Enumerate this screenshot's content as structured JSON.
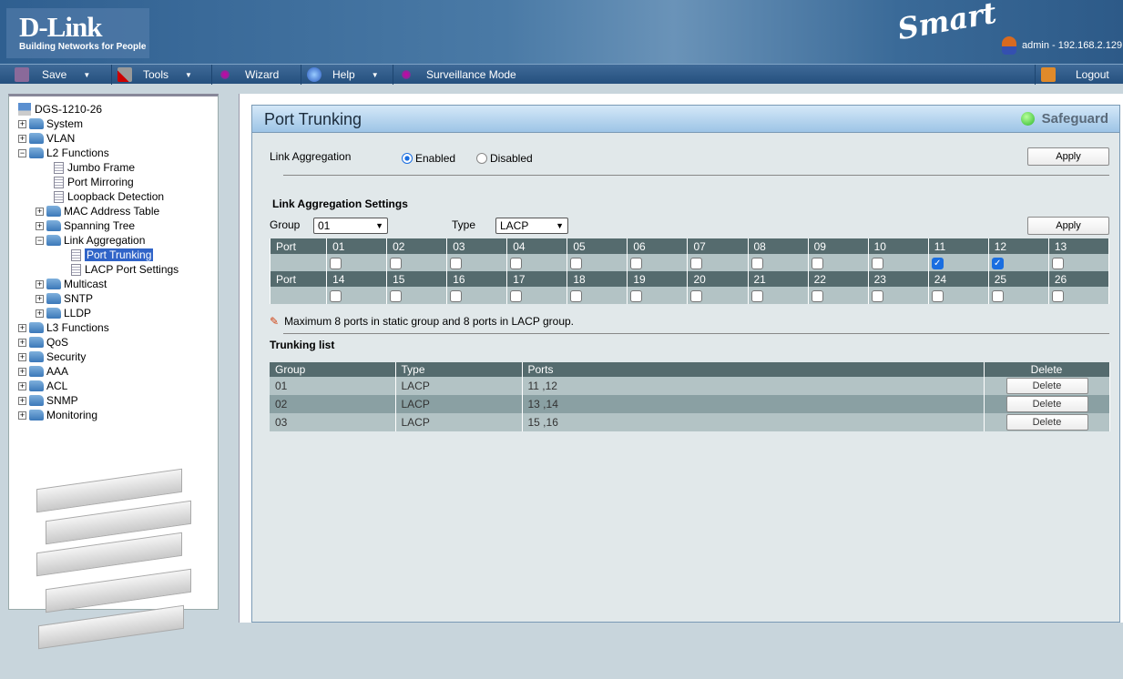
{
  "header": {
    "brand": "D-Link",
    "tagline": "Building Networks for People",
    "product_line": "Smart",
    "user": "admin - 192.168.2.129"
  },
  "menu": [
    {
      "label": "Save",
      "icon": "floppy-icon",
      "dropdown": true
    },
    {
      "label": "Tools",
      "icon": "tools-icon",
      "dropdown": true
    },
    {
      "label": "Wizard",
      "icon": "wand-icon",
      "dropdown": false
    },
    {
      "label": "Help",
      "icon": "help-icon",
      "dropdown": true
    },
    {
      "label": "Surveillance Mode",
      "icon": "wand-icon",
      "dropdown": false
    }
  ],
  "logout": "Logout",
  "tree": [
    {
      "label": "DGS-1210-26",
      "level": 0,
      "kind": "device"
    },
    {
      "label": "System",
      "level": 0,
      "kind": "folder",
      "exp": "+"
    },
    {
      "label": "VLAN",
      "level": 0,
      "kind": "folder",
      "exp": "+"
    },
    {
      "label": "L2 Functions",
      "level": 0,
      "kind": "folder",
      "exp": "-"
    },
    {
      "label": "Jumbo Frame",
      "level": 1,
      "kind": "page"
    },
    {
      "label": "Port Mirroring",
      "level": 1,
      "kind": "page"
    },
    {
      "label": "Loopback Detection",
      "level": 1,
      "kind": "page"
    },
    {
      "label": "MAC Address Table",
      "level": 1,
      "kind": "folder",
      "exp": "+"
    },
    {
      "label": "Spanning Tree",
      "level": 1,
      "kind": "folder",
      "exp": "+"
    },
    {
      "label": "Link Aggregation",
      "level": 1,
      "kind": "folder",
      "exp": "-"
    },
    {
      "label": "Port Trunking",
      "level": 2,
      "kind": "page",
      "selected": true
    },
    {
      "label": "LACP Port Settings",
      "level": 2,
      "kind": "page"
    },
    {
      "label": "Multicast",
      "level": 1,
      "kind": "folder",
      "exp": "+"
    },
    {
      "label": "SNTP",
      "level": 1,
      "kind": "folder",
      "exp": "+"
    },
    {
      "label": "LLDP",
      "level": 1,
      "kind": "folder",
      "exp": "+"
    },
    {
      "label": "L3 Functions",
      "level": 0,
      "kind": "folder",
      "exp": "+"
    },
    {
      "label": "QoS",
      "level": 0,
      "kind": "folder",
      "exp": "+"
    },
    {
      "label": "Security",
      "level": 0,
      "kind": "folder",
      "exp": "+"
    },
    {
      "label": "AAA",
      "level": 0,
      "kind": "folder",
      "exp": "+"
    },
    {
      "label": "ACL",
      "level": 0,
      "kind": "folder",
      "exp": "+"
    },
    {
      "label": "SNMP",
      "level": 0,
      "kind": "folder",
      "exp": "+"
    },
    {
      "label": "Monitoring",
      "level": 0,
      "kind": "folder",
      "exp": "+"
    }
  ],
  "page": {
    "title": "Port Trunking",
    "safeguard": "Safeguard",
    "link_aggregation": {
      "label": "Link Aggregation",
      "enabled": "Enabled",
      "disabled": "Disabled",
      "selected": "Enabled",
      "apply": "Apply"
    },
    "settings": {
      "heading": "Link Aggregation Settings",
      "group_label": "Group",
      "group_value": "01",
      "type_label": "Type",
      "type_value": "LACP",
      "apply": "Apply",
      "port_label": "Port",
      "ports_row1": [
        "01",
        "02",
        "03",
        "04",
        "05",
        "06",
        "07",
        "08",
        "09",
        "10",
        "11",
        "12",
        "13"
      ],
      "ports_row2": [
        "14",
        "15",
        "16",
        "17",
        "18",
        "19",
        "20",
        "21",
        "22",
        "23",
        "24",
        "25",
        "26"
      ],
      "checked": [
        "11",
        "12"
      ]
    },
    "note": "Maximum 8 ports in static group and 8 ports in LACP group.",
    "trunking_list": {
      "heading": "Trunking list",
      "columns": [
        "Group",
        "Type",
        "Ports",
        "Delete"
      ],
      "rows": [
        {
          "group": "01",
          "type": "LACP",
          "ports": "11 ,12",
          "action": "Delete"
        },
        {
          "group": "02",
          "type": "LACP",
          "ports": "13 ,14",
          "action": "Delete"
        },
        {
          "group": "03",
          "type": "LACP",
          "ports": "15 ,16",
          "action": "Delete"
        }
      ]
    }
  }
}
